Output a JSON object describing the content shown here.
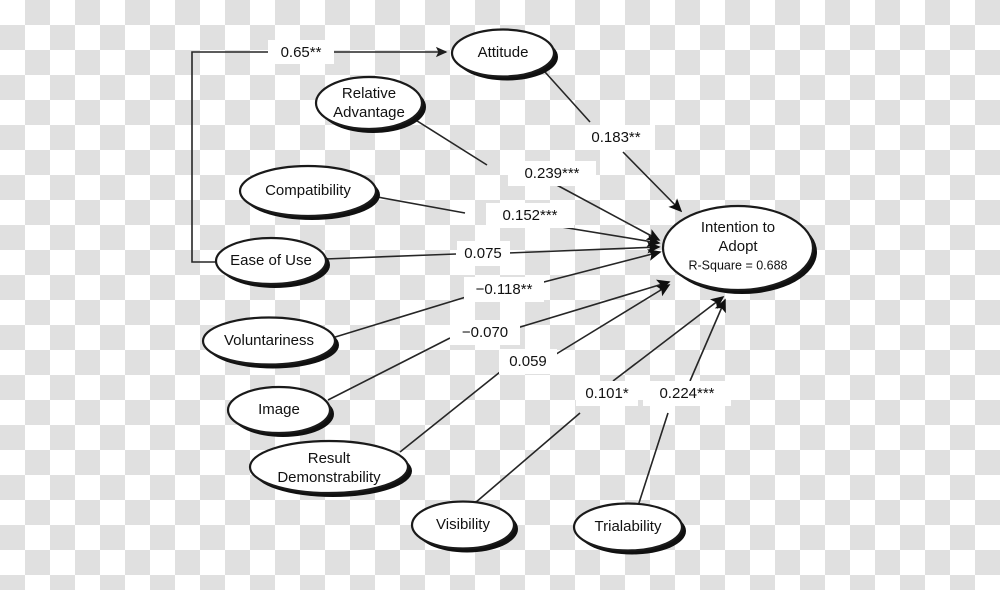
{
  "diagram": {
    "type": "path-diagram",
    "background": "transparency-checkerboard",
    "colors": {
      "node_fill": "#ffffff",
      "node_stroke": "#1a1a1a",
      "node_shadow": "#101010",
      "edge_stroke": "#262626",
      "text": "#111111",
      "checker_light": "#ffffff",
      "checker_dark": "#e0e0e0"
    },
    "nodes": [
      {
        "id": "attitude",
        "label": "Attitude",
        "label2": "",
        "label3": ""
      },
      {
        "id": "relative_adv",
        "label": "Relative",
        "label2": "Advantage",
        "label3": ""
      },
      {
        "id": "compatibility",
        "label": "Compatibility",
        "label2": "",
        "label3": ""
      },
      {
        "id": "ease_of_use",
        "label": "Ease of Use",
        "label2": "",
        "label3": ""
      },
      {
        "id": "voluntariness",
        "label": "Voluntariness",
        "label2": "",
        "label3": ""
      },
      {
        "id": "image",
        "label": "Image",
        "label2": "",
        "label3": ""
      },
      {
        "id": "result_demo",
        "label": "Result",
        "label2": "Demonstrability",
        "label3": ""
      },
      {
        "id": "visibility",
        "label": "Visibility",
        "label2": "",
        "label3": ""
      },
      {
        "id": "trialability",
        "label": "Trialability",
        "label2": "",
        "label3": ""
      },
      {
        "id": "intention",
        "label": "Intention to",
        "label2": "Adopt",
        "label3": "R-Square = 0.688"
      }
    ],
    "edges": [
      {
        "id": "ease_to_attitude",
        "from": "ease_of_use",
        "to": "attitude",
        "coefficient": "0.65**"
      },
      {
        "id": "attitude_to_intention",
        "from": "attitude",
        "to": "intention",
        "coefficient": "0.183**"
      },
      {
        "id": "reladv_to_intention",
        "from": "relative_adv",
        "to": "intention",
        "coefficient": "0.239***"
      },
      {
        "id": "compat_to_intention",
        "from": "compatibility",
        "to": "intention",
        "coefficient": "0.152***"
      },
      {
        "id": "ease_to_intention",
        "from": "ease_of_use",
        "to": "intention",
        "coefficient": "0.075"
      },
      {
        "id": "volunt_to_intention",
        "from": "voluntariness",
        "to": "intention",
        "coefficient": "−0.118**"
      },
      {
        "id": "image_to_intention",
        "from": "image",
        "to": "intention",
        "coefficient": "−0.070"
      },
      {
        "id": "resultdemo_to_intention",
        "from": "result_demo",
        "to": "intention",
        "coefficient": "0.059"
      },
      {
        "id": "visibility_to_intention",
        "from": "visibility",
        "to": "intention",
        "coefficient": "0.101*"
      },
      {
        "id": "trial_to_intention",
        "from": "trialability",
        "to": "intention",
        "coefficient": "0.224***"
      }
    ]
  }
}
